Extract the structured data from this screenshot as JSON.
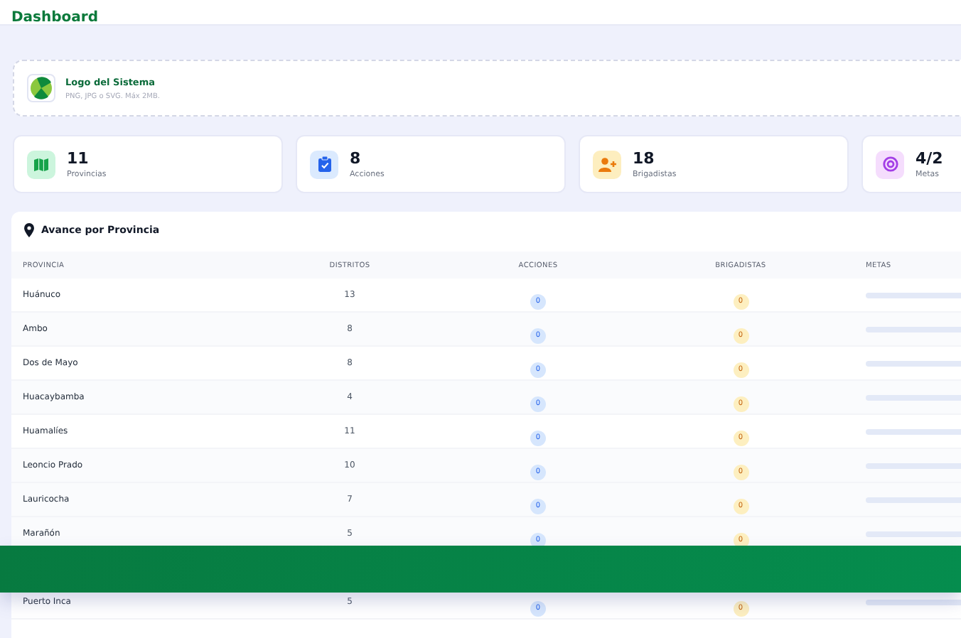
{
  "header": {
    "title": "Dashboard"
  },
  "logo_card": {
    "title": "Logo del Sistema",
    "hint": "PNG, JPG o SVG. Máx 2MB."
  },
  "stats": [
    {
      "kind": "map",
      "value": "11",
      "label": "Provincias"
    },
    {
      "kind": "clipboard",
      "value": "8",
      "label": "Acciones"
    },
    {
      "kind": "user-plus",
      "value": "18",
      "label": "Brigadistas"
    },
    {
      "kind": "target",
      "value": "4/2",
      "label": "Metas"
    }
  ],
  "table": {
    "title": "Avance por Provincia",
    "columns": [
      "PROVINCIA",
      "DISTRITOS",
      "ACCIONES",
      "BRIGADISTAS",
      "METAS"
    ],
    "rows": [
      {
        "provincia": "Huánuco",
        "distritos": "13",
        "acciones": "0",
        "brigadistas": "0",
        "level": 0
      },
      {
        "provincia": "Ambo",
        "distritos": "8",
        "acciones": "0",
        "brigadistas": "0",
        "level": 0
      },
      {
        "provincia": "Dos de Mayo",
        "distritos": "8",
        "acciones": "0",
        "brigadistas": "0",
        "level": 0
      },
      {
        "provincia": "Huacaybamba",
        "distritos": "4",
        "acciones": "0",
        "brigadistas": "0",
        "level": 0
      },
      {
        "provincia": "Huamalíes",
        "distritos": "11",
        "acciones": "0",
        "brigadistas": "0",
        "level": 0
      },
      {
        "provincia": "Leoncio Prado",
        "distritos": "10",
        "acciones": "0",
        "brigadistas": "0",
        "level": 0
      },
      {
        "provincia": "Lauricocha",
        "distritos": "7",
        "acciones": "0",
        "brigadistas": "0",
        "level": 0
      },
      {
        "provincia": "Marañón",
        "distritos": "5",
        "acciones": "0",
        "brigadistas": "0",
        "level": 0
      },
      {
        "provincia": "Puerto Inca",
        "distritos": "5",
        "acciones": "0",
        "brigadistas": "0",
        "level": 0
      }
    ]
  }
}
